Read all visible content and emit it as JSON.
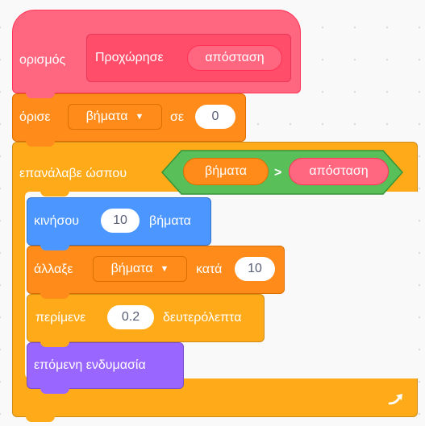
{
  "define_block": {
    "keyword": "ορισμός",
    "name": "Προχώρησε",
    "param": "απόσταση",
    "color": "#ff6680"
  },
  "set_block": {
    "keyword": "όρισε",
    "variable": "βήματα",
    "preposition": "σε",
    "value": "0",
    "color": "#ff8c1a"
  },
  "repeat_block": {
    "keyword": "επανάλαβε ώσπου",
    "condition": {
      "left": "βήματα",
      "operator": ">",
      "right": "απόσταση",
      "operator_color": "#59c059"
    },
    "loop_icon": "loop-arrow-icon",
    "color": "#ffab19"
  },
  "move_block": {
    "keyword": "κινήσου",
    "value": "10",
    "unit": "βήματα",
    "color": "#4c97ff"
  },
  "change_block": {
    "keyword": "άλλαξε",
    "variable": "βήματα",
    "preposition": "κατά",
    "value": "10",
    "color": "#ff8c1a"
  },
  "wait_block": {
    "keyword": "περίμενε",
    "value": "0.2",
    "unit": "δευτερόλεπτα",
    "color": "#ffab19"
  },
  "costume_block": {
    "label": "επόμενη ενδυμασία",
    "color": "#9966ff"
  }
}
